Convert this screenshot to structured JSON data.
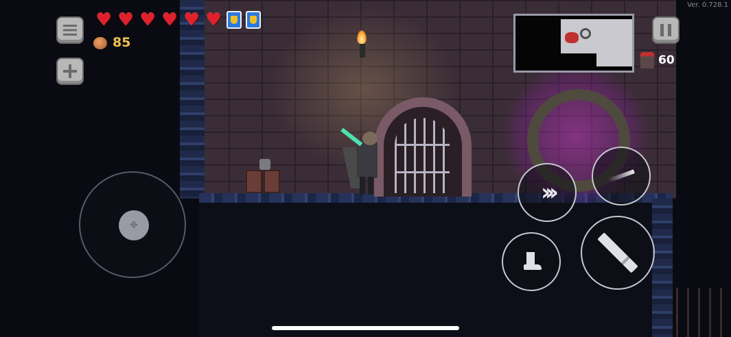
{
  "version": "Ver. 0.728.1",
  "hud": {
    "health_hearts": 6,
    "shields": 2,
    "coins": "85",
    "enemies_remaining": "60"
  },
  "icons": {
    "menu": "menu-icon",
    "add": "plus-icon",
    "pause": "pause-icon",
    "heart": "heart-icon",
    "shield": "shield-icon",
    "coin": "coin-icon",
    "enemy": "enemy-icon"
  },
  "colors": {
    "heart": "#e0202a",
    "shield": "#2a7ae0",
    "coin_text": "#f0c050",
    "portal": "#d040d0"
  }
}
